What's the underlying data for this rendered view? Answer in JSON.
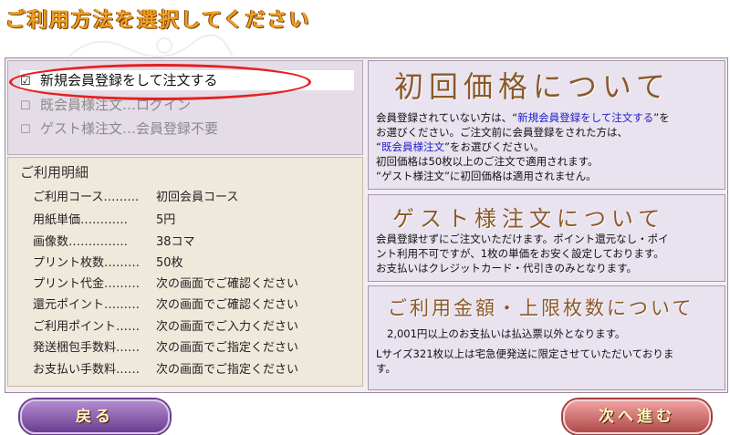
{
  "page": {
    "title": "ご利用方法を選択してください"
  },
  "options": [
    {
      "box": "☑",
      "label": "新規会員登録をして注文する"
    },
    {
      "box": "☐",
      "label": "既会員様注文…ログイン"
    },
    {
      "box": "☐",
      "label": "ゲスト様注文…会員登録不要"
    }
  ],
  "details": {
    "title": "ご利用明細",
    "rows": [
      {
        "label": "ご利用コース………",
        "value": "初回会員コース"
      },
      {
        "label": "用紙単価…………",
        "value": "5円"
      },
      {
        "label": "画像数……………",
        "value": "38コマ"
      },
      {
        "label": "プリント枚数………",
        "value": "50枚"
      },
      {
        "label": "プリント代金………",
        "value": "次の画面でご確認ください"
      },
      {
        "label": "還元ポイント………",
        "value": "次の画面でご確認ください"
      },
      {
        "label": "ご利用ポイント……",
        "value": "次の画面でご入力ください"
      },
      {
        "label": "発送梱包手数料……",
        "value": "次の画面でご指定ください"
      },
      {
        "label": "お支払い手数料……",
        "value": "次の画面でご指定ください"
      }
    ]
  },
  "panel1": {
    "heading": "初回価格について",
    "l1_a": "会員登録されていない方は、“",
    "l1_link": "新規会員登録をして注文する",
    "l1_b": "”を",
    "l2": "お選びください。ご注文前に会員登録をされた方は、",
    "l3_a": "“",
    "l3_link": "既会員様注文",
    "l3_b": "”をお選びください。",
    "l4": "初回価格は50枚以上のご注文で適用されます。",
    "l5": "“ゲスト様注文”に初回価格は適用されません。"
  },
  "panel2": {
    "heading": "ゲスト様注文について",
    "l1": "会員登録せずにご注文いただけます。ポイント還元なし・ポイ",
    "l2": "ント利用不可ですが、1枚の単価をお安く設定しております。",
    "l3": "お支払いはクレジットカード・代引きのみとなります。"
  },
  "panel3": {
    "heading": "ご利用金額・上限枚数について",
    "l1": "2,001円以上のお支払いは払込票以外となります。",
    "l2": "Lサイズ321枚以上は宅急便発送に限定させていただいておりま",
    "l3": "す。"
  },
  "buttons": {
    "back": "戻る",
    "next": "次へ進む"
  },
  "colors": {
    "title": "#f0a020",
    "selection_oval": "#e52020",
    "link": "#2222cc"
  }
}
